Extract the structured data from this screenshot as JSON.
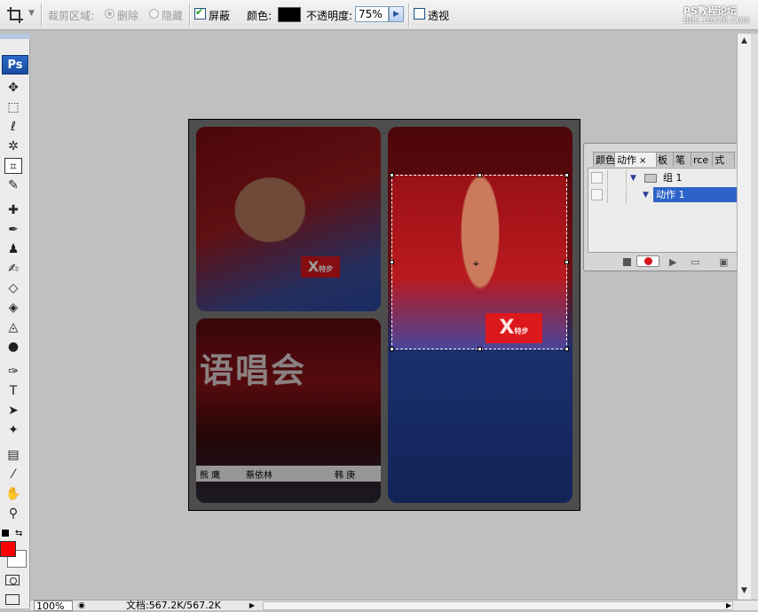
{
  "options_bar": {
    "crop_area_label": "裁剪区域:",
    "delete_label": "删除",
    "hide_label": "隐藏",
    "shield_label": "屏蔽",
    "shield_checked": true,
    "color_label": "颜色:",
    "color_value": "#000000",
    "opacity_label": "不透明度:",
    "opacity_value": "75%",
    "perspective_label": "透视",
    "perspective_checked": false
  },
  "watermark": {
    "line1": "PS教程论坛",
    "line2": "BBS.16XX8.COM"
  },
  "toolbox": {
    "ps_badge": "Ps",
    "foreground_color": "#ff0000",
    "background_color": "#ffffff",
    "active_tool": "crop-tool"
  },
  "canvas": {
    "banner_text": "语唱会",
    "mic_flag_text": "X",
    "mic_flag_sub": "特步",
    "name_tags": [
      "熊 鹰",
      "蔡依林",
      "韩 庚"
    ]
  },
  "actions_panel": {
    "tabs": [
      {
        "label": "颜色"
      },
      {
        "label": "动作",
        "active": true
      },
      {
        "label": "板"
      },
      {
        "label": "笔"
      },
      {
        "label": "rce"
      },
      {
        "label": "式"
      }
    ],
    "close_glyph": "×",
    "rows": [
      {
        "label": "组 1",
        "type": "set",
        "selected": false
      },
      {
        "label": "动作 1",
        "type": "action",
        "selected": true
      }
    ]
  },
  "status_bar": {
    "zoom": "100%",
    "doc_info": "文档:567.2K/567.2K"
  }
}
